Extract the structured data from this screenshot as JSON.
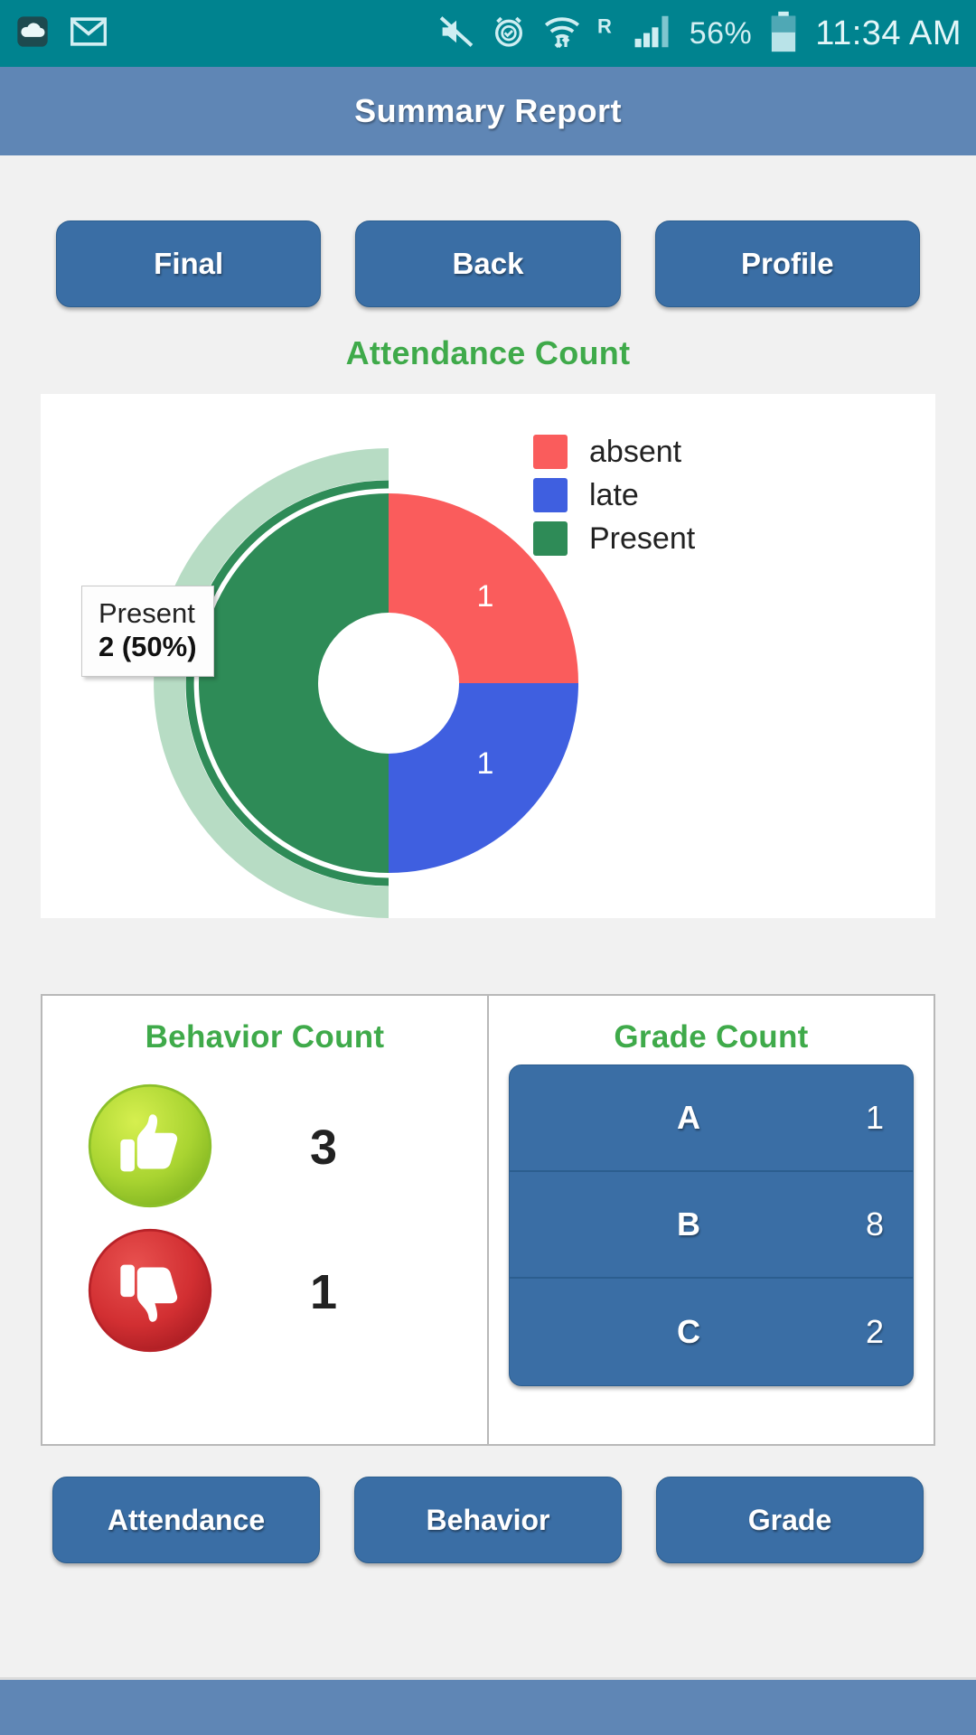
{
  "statusbar": {
    "icons": [
      "cloud-upload-icon",
      "gmail-icon",
      "mute-icon",
      "alarm-icon",
      "wifi-icon",
      "roaming-icon",
      "signal-icon"
    ],
    "battery_percent": "56%",
    "time": "11:34 AM"
  },
  "header": {
    "title": "Summary Report"
  },
  "toolbar": {
    "final_label": "Final",
    "back_label": "Back",
    "profile_label": "Profile"
  },
  "attendance": {
    "title": "Attendance Count",
    "tooltip": {
      "label": "Present",
      "value": "2 (50%)"
    }
  },
  "chart_data": {
    "type": "pie",
    "title": "Attendance Count",
    "labels": [
      "absent",
      "late",
      "Present"
    ],
    "values": [
      1,
      1,
      2
    ],
    "percents": [
      25,
      25,
      50
    ],
    "data_labels": [
      "1",
      "1",
      "2"
    ],
    "colors": [
      "#fa5c5c",
      "#3f5fe0",
      "#2e8b57"
    ],
    "legend_position": "right",
    "donut": true,
    "highlighted_slice": "Present",
    "highlight_color": "#b7dcc4",
    "total": 4
  },
  "behavior": {
    "title": "Behavior Count",
    "rows": [
      {
        "icon": "thumbs-up-icon",
        "count": "3"
      },
      {
        "icon": "thumbs-down-icon",
        "count": "1"
      }
    ]
  },
  "grade": {
    "title": "Grade Count",
    "rows": [
      {
        "letter": "A",
        "value": "1"
      },
      {
        "letter": "B",
        "value": "8"
      },
      {
        "letter": "C",
        "value": "2"
      }
    ]
  },
  "footer": {
    "attendance_label": "Attendance",
    "behavior_label": "Behavior",
    "grade_label": "Grade"
  },
  "colors": {
    "status_bar": "#00838f",
    "title_bar": "#5f86b5",
    "button_blue": "#3a6ea5",
    "heading_green": "#3faa4a",
    "absent_red": "#fa5c5c",
    "late_blue": "#3f5fe0",
    "present_green": "#2e8b57"
  }
}
